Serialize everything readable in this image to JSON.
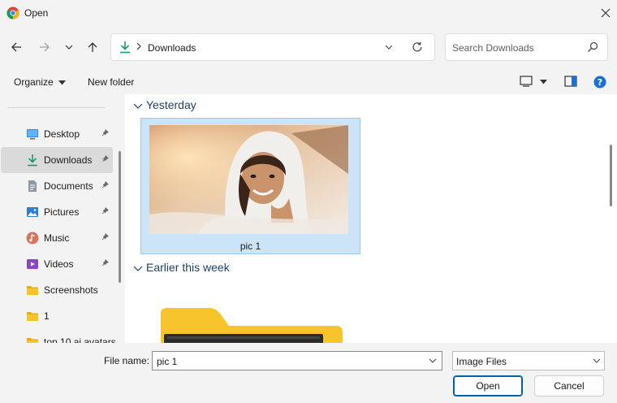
{
  "window": {
    "title": "Open"
  },
  "address_bar": {
    "path": "Downloads"
  },
  "search": {
    "placeholder": "Search Downloads"
  },
  "toolbar": {
    "organize_label": "Organize",
    "new_folder_label": "New folder"
  },
  "sidebar": {
    "items": [
      {
        "label": "Desktop",
        "icon": "desktop-icon",
        "pinned": true
      },
      {
        "label": "Downloads",
        "icon": "downloads-icon",
        "pinned": true,
        "selected": true
      },
      {
        "label": "Documents",
        "icon": "documents-icon",
        "pinned": true
      },
      {
        "label": "Pictures",
        "icon": "pictures-icon",
        "pinned": true
      },
      {
        "label": "Music",
        "icon": "music-icon",
        "pinned": true
      },
      {
        "label": "Videos",
        "icon": "videos-icon",
        "pinned": true
      },
      {
        "label": "Screenshots",
        "icon": "folder-icon",
        "pinned": false
      },
      {
        "label": "1",
        "icon": "folder-icon",
        "pinned": false
      },
      {
        "label": "top 10 ai avatars",
        "icon": "folder-icon",
        "pinned": false
      }
    ]
  },
  "content": {
    "groups": [
      {
        "title": "Yesterday",
        "files": [
          {
            "name": "pic 1",
            "selected": true
          }
        ]
      },
      {
        "title": "Earlier this week",
        "files": []
      }
    ]
  },
  "footer": {
    "file_name_label": "File name:",
    "file_name_value": "pic 1",
    "file_type": "Image Files",
    "open_label": "Open",
    "cancel_label": "Cancel"
  },
  "colors": {
    "accent": "#005fb8",
    "selection": "#cce4f7",
    "folder": "#f8c42c",
    "download_green": "#1c9b6c"
  }
}
